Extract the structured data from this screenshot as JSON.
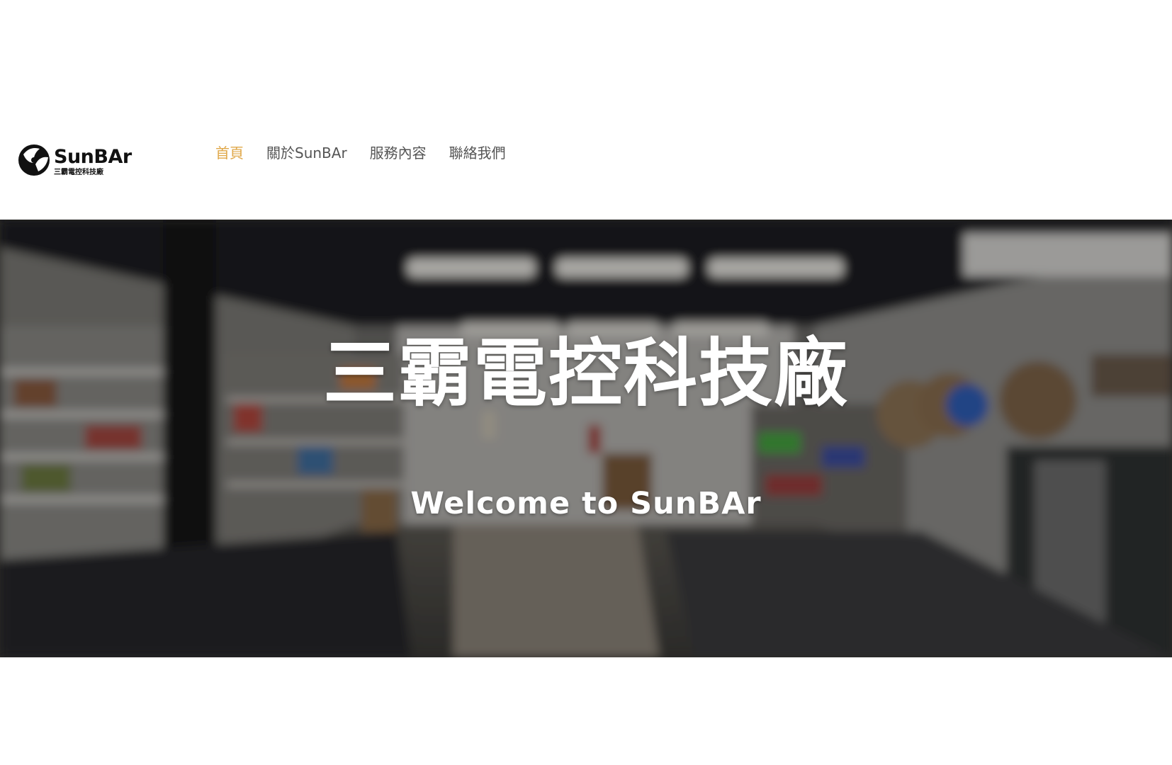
{
  "logo": {
    "wordmark": "SunBAr",
    "subtitle": "三霸電控科技廠"
  },
  "nav": {
    "items": [
      {
        "label": "首頁",
        "active": true
      },
      {
        "label": "關於SunBAr",
        "active": false
      },
      {
        "label": "服務內容",
        "active": false
      },
      {
        "label": "聯絡我們",
        "active": false
      }
    ]
  },
  "hero": {
    "title": "三霸電控科技廠",
    "subtitle": "Welcome to SunBAr"
  },
  "colors": {
    "accent": "#e0a84a",
    "nav_text": "#555555",
    "hero_text": "#ffffff"
  }
}
